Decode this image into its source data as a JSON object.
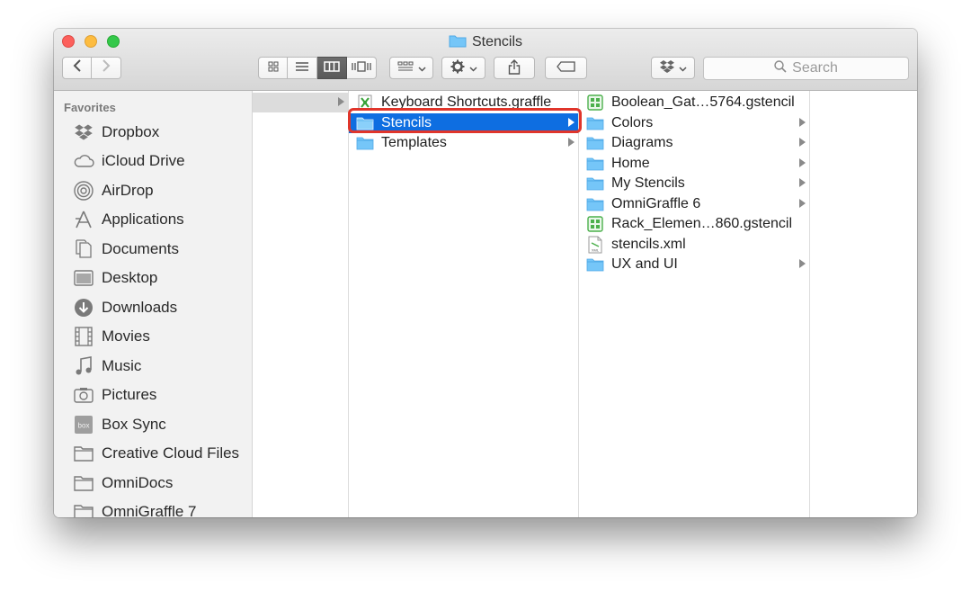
{
  "window": {
    "title": "Stencils"
  },
  "toolbar": {
    "search_placeholder": "Search"
  },
  "sidebar": {
    "header": "Favorites",
    "items": [
      {
        "label": "Dropbox",
        "icon": "dropbox-icon"
      },
      {
        "label": "iCloud Drive",
        "icon": "cloud-icon"
      },
      {
        "label": "AirDrop",
        "icon": "airdrop-icon"
      },
      {
        "label": "Applications",
        "icon": "applications-icon"
      },
      {
        "label": "Documents",
        "icon": "documents-icon"
      },
      {
        "label": "Desktop",
        "icon": "desktop-icon"
      },
      {
        "label": "Downloads",
        "icon": "downloads-icon"
      },
      {
        "label": "Movies",
        "icon": "movies-icon"
      },
      {
        "label": "Music",
        "icon": "music-icon"
      },
      {
        "label": "Pictures",
        "icon": "pictures-icon"
      },
      {
        "label": "Box Sync",
        "icon": "box-icon"
      },
      {
        "label": "Creative Cloud Files",
        "icon": "folder-icon"
      },
      {
        "label": "OmniDocs",
        "icon": "folder-icon"
      },
      {
        "label": "OmniGraffle 7",
        "icon": "folder-icon"
      }
    ]
  },
  "columns": {
    "col2": [
      {
        "name": "Keyboard Shortcuts.graffle",
        "type": "graffle",
        "arrow": false
      },
      {
        "name": "Stencils",
        "type": "folder",
        "arrow": true,
        "selected": true
      },
      {
        "name": "Templates",
        "type": "folder",
        "arrow": true
      }
    ],
    "col3": [
      {
        "name": "Boolean_Gat…5764.gstencil",
        "type": "gstencil",
        "arrow": false
      },
      {
        "name": "Colors",
        "type": "folder",
        "arrow": true
      },
      {
        "name": "Diagrams",
        "type": "folder",
        "arrow": true
      },
      {
        "name": "Home",
        "type": "folder",
        "arrow": true
      },
      {
        "name": "My Stencils",
        "type": "folder",
        "arrow": true
      },
      {
        "name": "OmniGraffle 6",
        "type": "folder",
        "arrow": true
      },
      {
        "name": "Rack_Elemen…860.gstencil",
        "type": "gstencil",
        "arrow": false
      },
      {
        "name": "stencils.xml",
        "type": "xml",
        "arrow": false
      },
      {
        "name": "UX and UI",
        "type": "folder",
        "arrow": true
      }
    ]
  },
  "colors": {
    "selection": "#0e6ee1",
    "highlight_ring": "#e0352b",
    "folder": "#75c6f8"
  }
}
